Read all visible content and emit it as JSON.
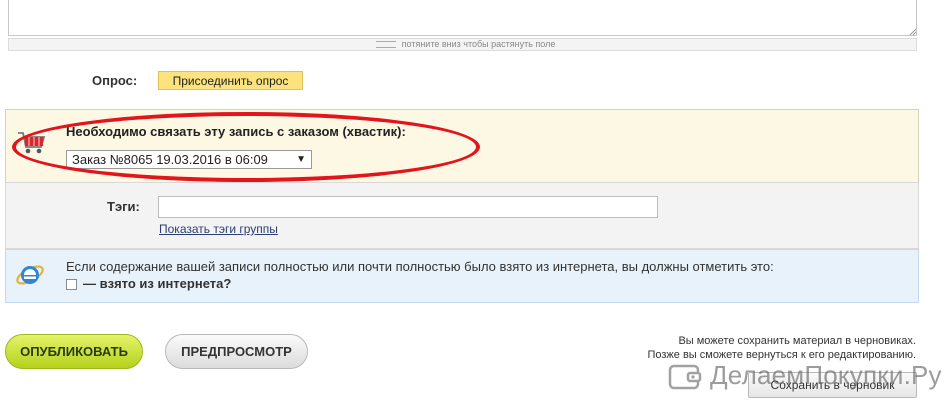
{
  "editor": {
    "resize_hint": "потяните вниз чтобы растянуть поле"
  },
  "poll": {
    "label": "Опрос:",
    "attach_button": "Присоединить опрос"
  },
  "order": {
    "title": "Необходимо связать эту запись с заказом (хвастик):",
    "selected": "Заказ №8065 19.03.2016 в 06:09",
    "arrow": "▼",
    "highlight_color": "#e2141c"
  },
  "tags": {
    "label": "Тэги:",
    "value": "",
    "show_group_tags": "Показать тэги группы"
  },
  "internet": {
    "notice": "Если содержание вашей записи полностью или почти полностью было взято из интернета, вы должны отметить это:",
    "checkbox_label": "— взято из интернета?",
    "checked": false
  },
  "actions": {
    "publish": "ОПУБЛИКОВАТЬ",
    "preview": "ПРЕДПРОСМОТР",
    "draft_note_line1": "Вы можете сохранить материал в черновиках.",
    "draft_note_line2": "Позже вы сможете вернуться к его редактированию.",
    "save_draft": "Сохранить в черновик"
  },
  "watermark": {
    "text": "ДелаемПокупки.Ру"
  }
}
